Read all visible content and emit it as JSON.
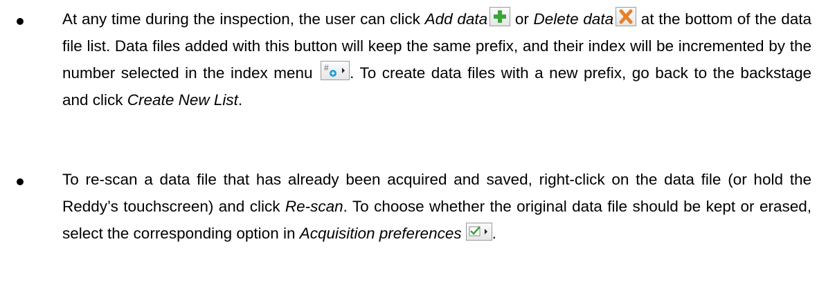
{
  "bullets": [
    {
      "parts": {
        "t1": "At any time during the inspection, the user can click ",
        "add_label": "Add data",
        "t2": " or ",
        "delete_label": "Delete data",
        "t3": " at the bottom of the data file list. Data files added with this button will keep the same prefix, and their index will be incremented by the number selected in the index menu ",
        "t4": ". To create data files with a new prefix, go back to the backstage and click ",
        "create_label": "Create New List",
        "t5": "."
      },
      "icons": [
        "add-data-icon",
        "delete-data-icon",
        "index-menu-icon"
      ]
    },
    {
      "parts": {
        "t1": "To re-scan a data file that has already been acquired and saved, right-click on the data file (or hold the Reddy’s touchscreen) and click ",
        "rescan_label": "Re-scan",
        "t2": ". To choose whether the original data file should be kept or erased, select the corresponding option in ",
        "acq_label": "Acquisition preferences",
        "t3": "."
      },
      "icons": [
        "acquisition-preferences-icon"
      ]
    }
  ],
  "colors": {
    "add_icon": "#3aa635",
    "delete_icon": "#e8802a",
    "index_icon": "#1f9bd6",
    "check_icon": "#3aa635"
  }
}
